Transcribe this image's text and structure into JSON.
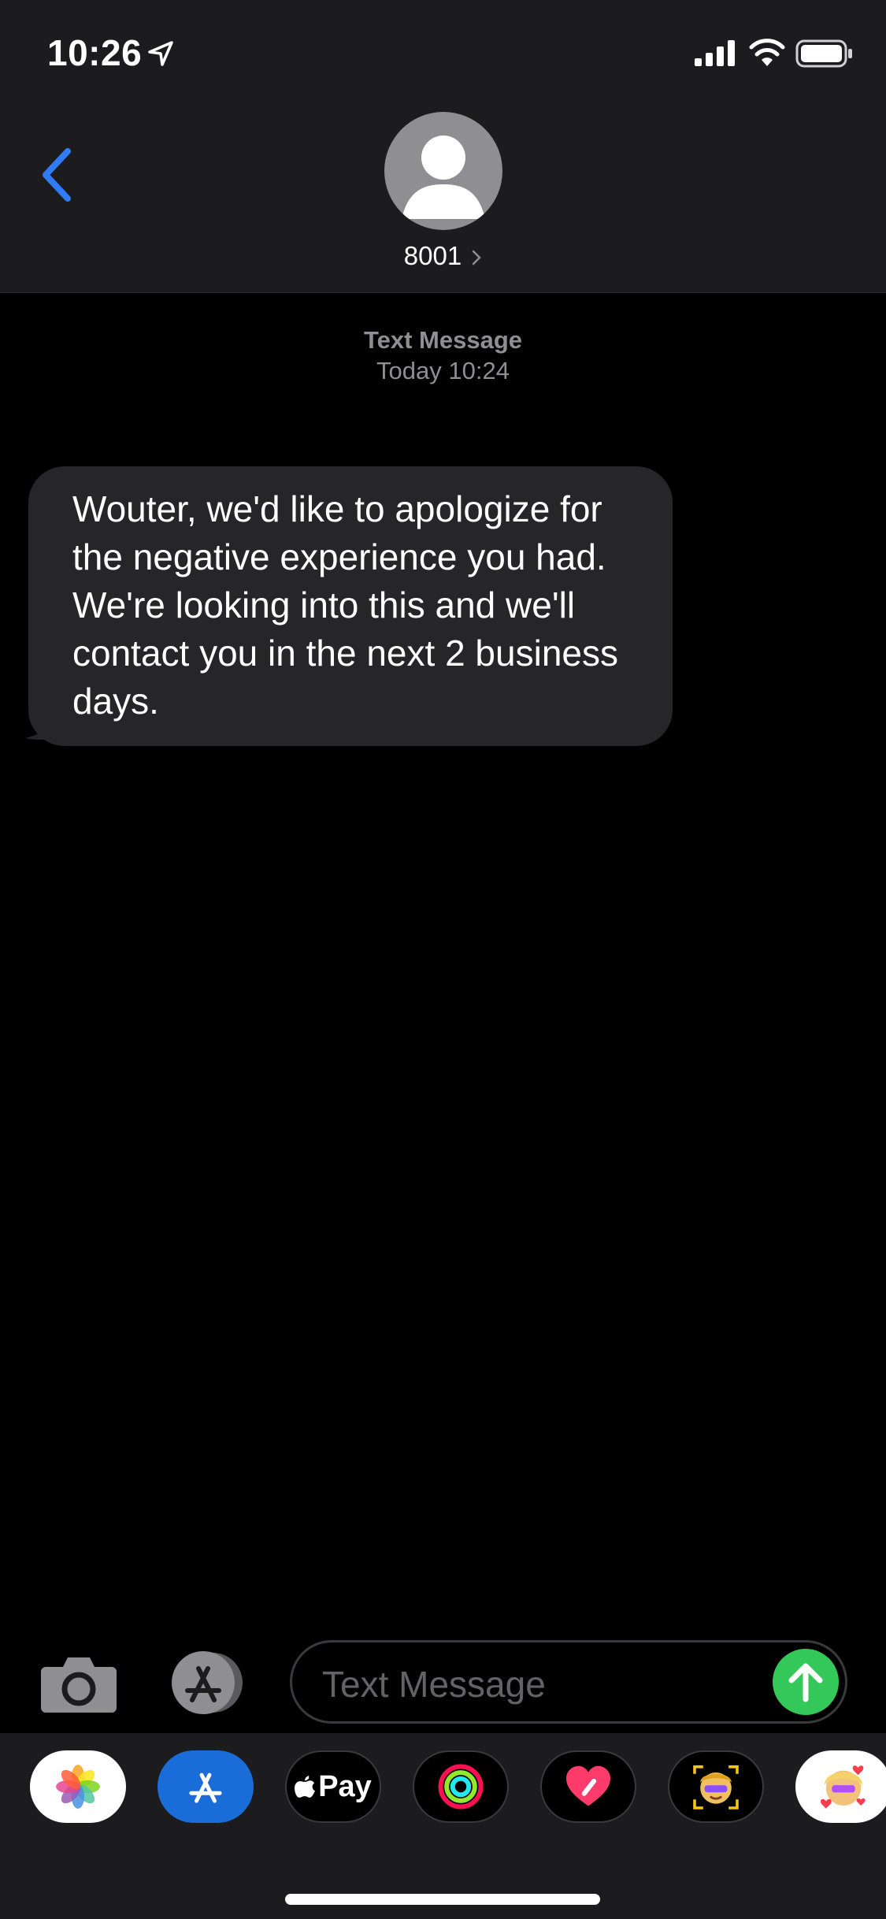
{
  "status_bar": {
    "time": "10:26",
    "location_icon": "location-arrow-icon",
    "signal_icon": "cellular-signal-icon",
    "wifi_icon": "wifi-icon",
    "battery_icon": "battery-icon"
  },
  "header": {
    "back_icon": "chevron-left-icon",
    "avatar_icon": "person-silhouette-icon",
    "contact_name": "8001",
    "contact_chevron_icon": "chevron-right-icon"
  },
  "conversation": {
    "timestamp_label": "Text Message",
    "timestamp_time": "Today 10:24",
    "messages": [
      {
        "direction": "incoming",
        "text": "Wouter, we'd like to apologize for the negative experience you had. We're looking into this and we'll contact you in the next 2 business days."
      }
    ]
  },
  "input_bar": {
    "camera_icon": "camera-icon",
    "apps_icon": "app-store-icon",
    "placeholder": "Text Message",
    "send_icon": "arrow-up-icon"
  },
  "app_drawer": {
    "items": [
      {
        "name": "photos",
        "icon": "photos-icon"
      },
      {
        "name": "app-store",
        "icon": "app-store-icon"
      },
      {
        "name": "apple-pay",
        "label": "Pay",
        "icon": "apple-pay-icon"
      },
      {
        "name": "activity",
        "icon": "activity-rings-icon"
      },
      {
        "name": "digital-touch",
        "icon": "digital-touch-heart-icon"
      },
      {
        "name": "animoji",
        "icon": "animoji-icon"
      },
      {
        "name": "memoji",
        "icon": "memoji-icon"
      }
    ]
  },
  "colors": {
    "background": "#000000",
    "bar_background": "#1c1c1e",
    "incoming_bubble": "#262628",
    "accent_blue": "#2f7cf6",
    "send_green": "#34c759",
    "secondary_text": "#8e8e93"
  }
}
